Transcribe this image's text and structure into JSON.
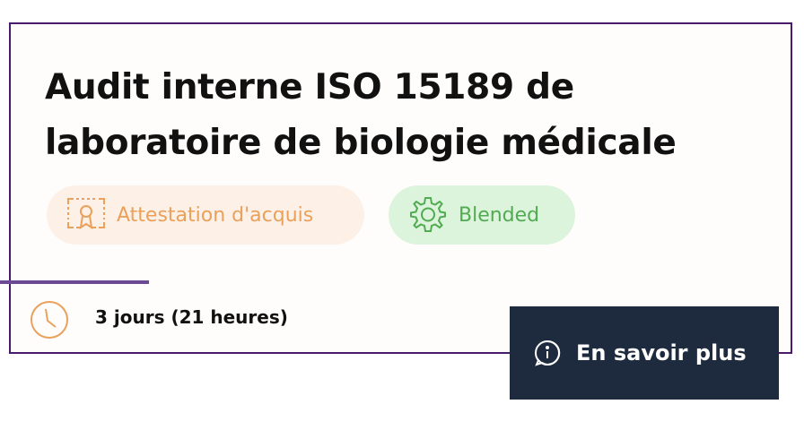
{
  "course": {
    "title_line1": "Audit interne ISO 15189 de",
    "title_line2": "laboratoire de biologie médicale",
    "duration": "3 jours (21 heures)"
  },
  "badges": [
    {
      "label": "Attestation d'acquis",
      "icon": "certificate-icon",
      "color": "#e9a15c",
      "background": "#fdf0e6"
    },
    {
      "label": "Blended",
      "icon": "gear-icon",
      "color": "#52ab52",
      "background": "#dcf3dc"
    }
  ],
  "cta": {
    "label": "En savoir plus",
    "icon": "info-icon",
    "background": "#1e2a3d"
  },
  "colors": {
    "card_border": "#4a1a6b",
    "accent_line": "#6b4a93",
    "clock": "#e9a15c"
  }
}
